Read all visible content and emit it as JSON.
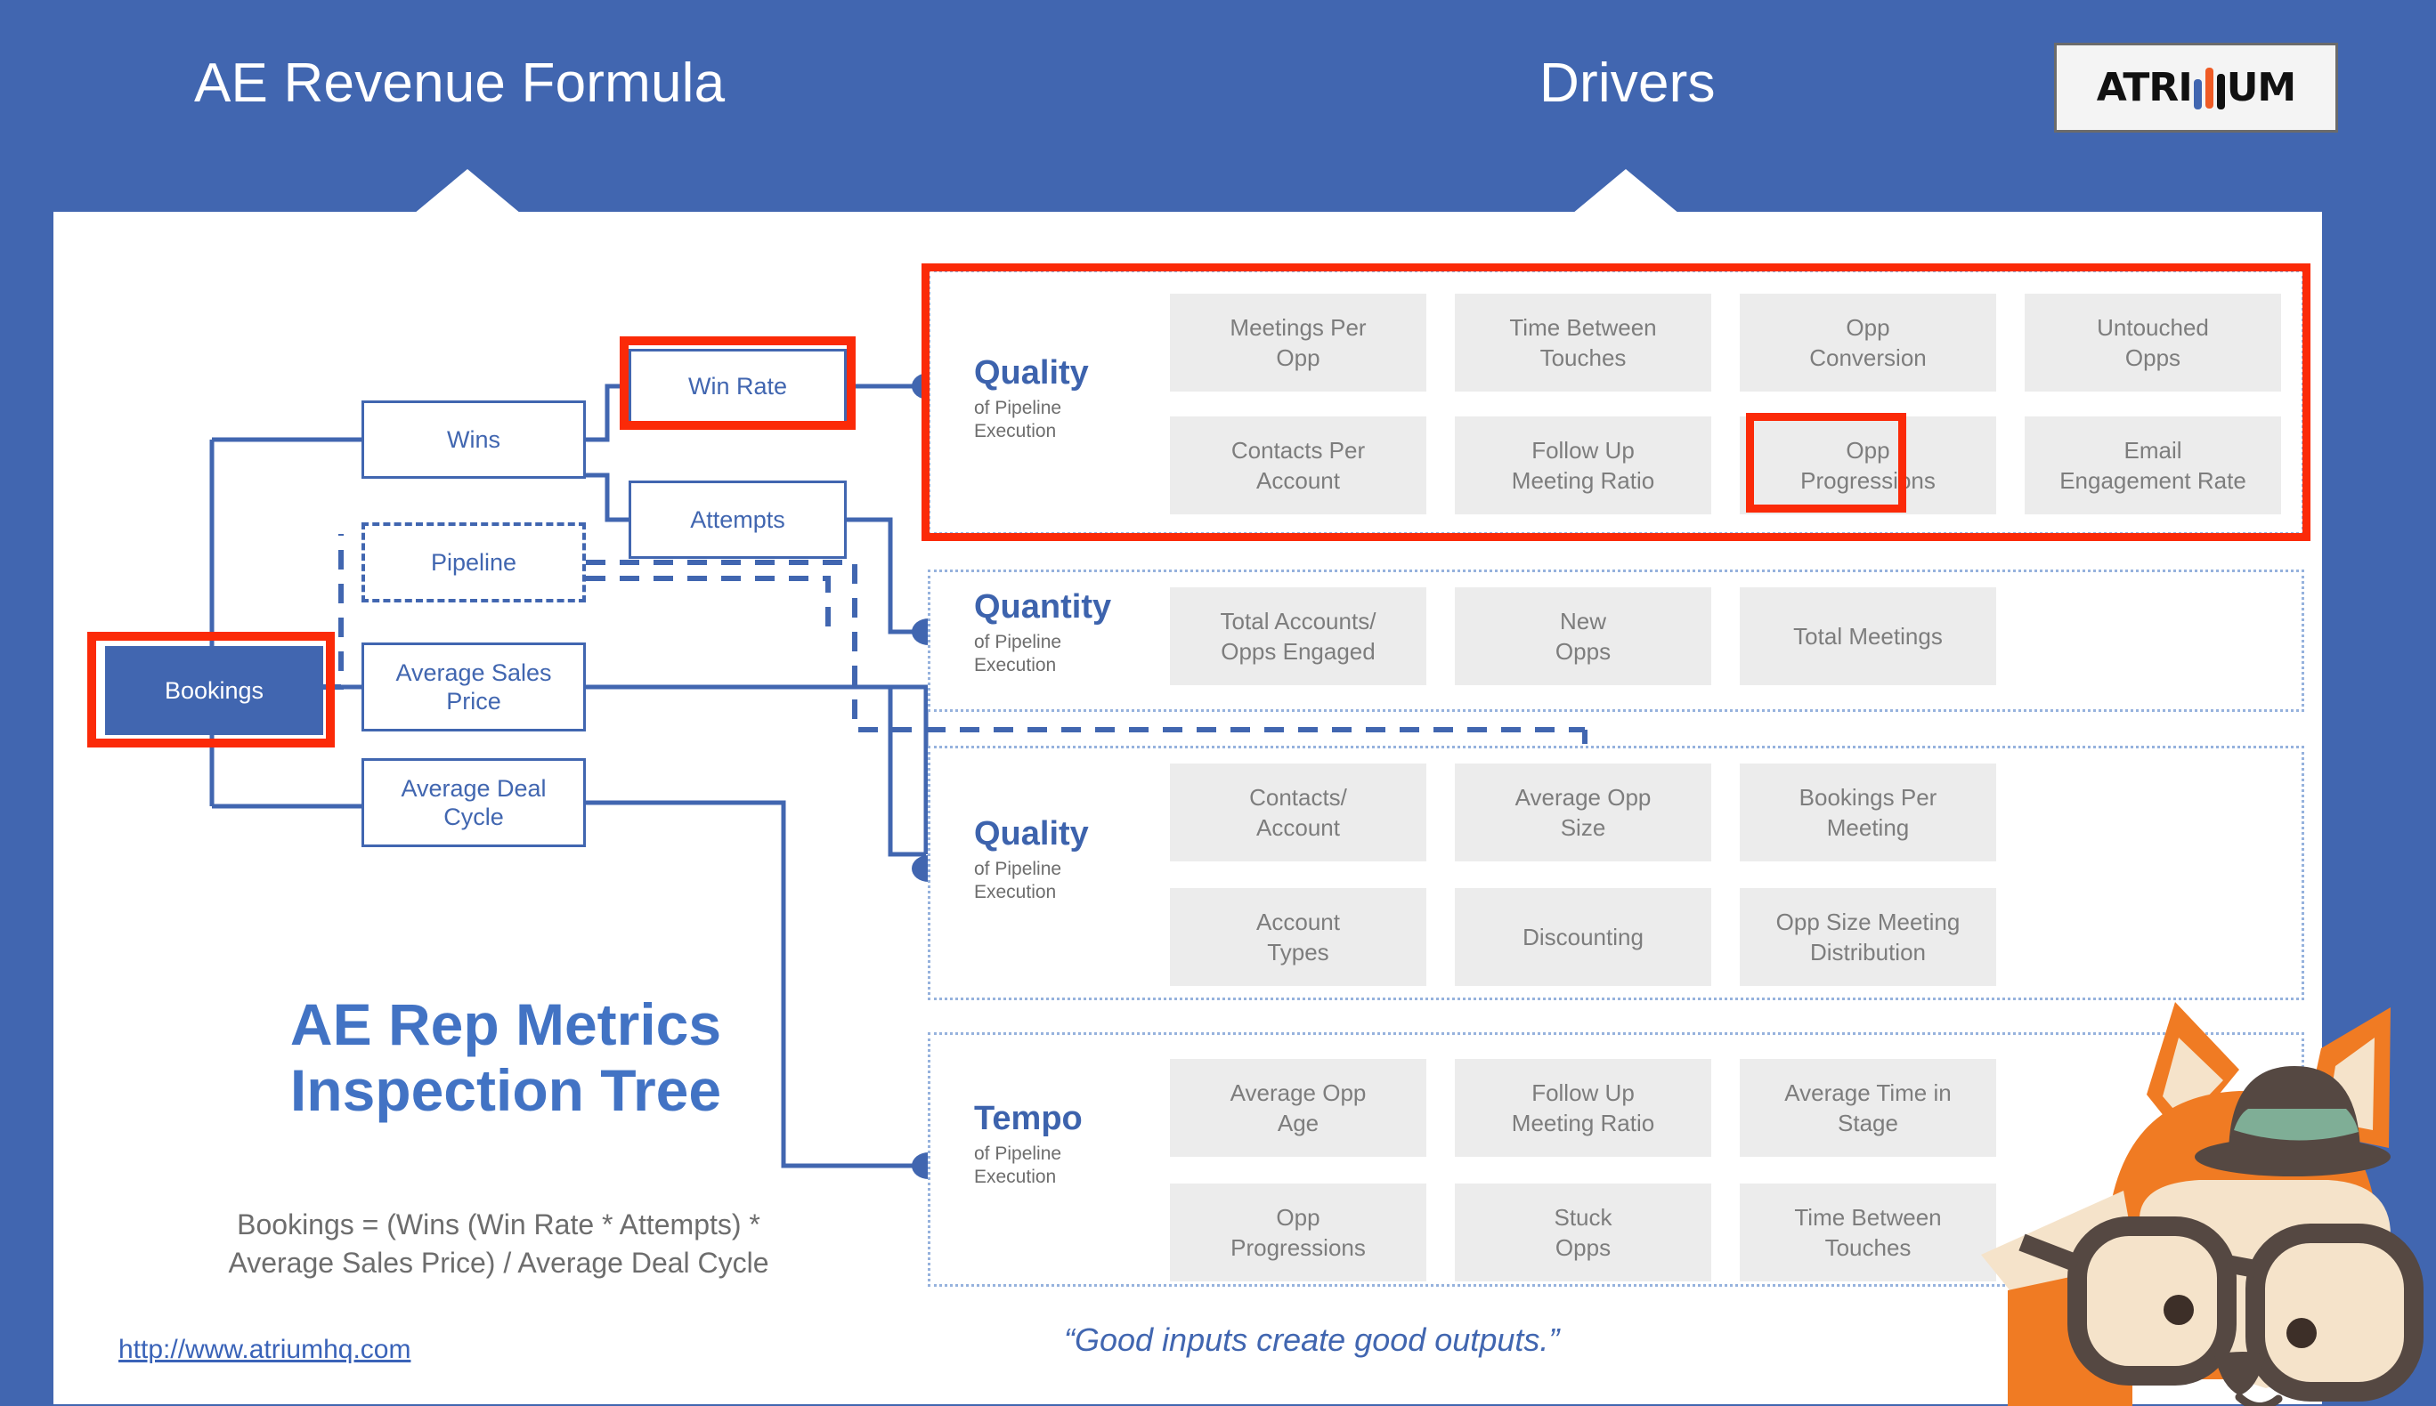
{
  "header": {
    "left_title": "AE Revenue Formula",
    "right_title": "Drivers",
    "logo": {
      "text_left": "ATRI",
      "text_right": "UM"
    }
  },
  "tree": {
    "root": "Bookings",
    "nodes": {
      "wins": "Wins",
      "win_rate": "Win Rate",
      "attempts": "Attempts",
      "pipeline": "Pipeline",
      "average_sales_price": "Average Sales\nPrice",
      "average_deal_cycle": "Average Deal\nCycle"
    }
  },
  "drivers": [
    {
      "id": "quality-1",
      "title": "Quality",
      "subtitle": "of Pipeline\nExecution",
      "highlighted": true,
      "cards": [
        "Meetings Per\nOpp",
        "Time Between\nTouches",
        "Opp\nConversion",
        "Untouched\nOpps",
        "Contacts Per\nAccount",
        "Follow Up\nMeeting Ratio",
        "Opp\nProgressions",
        "Email\nEngagement Rate"
      ],
      "highlighted_card": "Opp\nProgressions"
    },
    {
      "id": "quantity",
      "title": "Quantity",
      "subtitle": "of Pipeline\nExecution",
      "highlighted": false,
      "cards": [
        "Total Accounts/\nOpps Engaged",
        "New\nOpps",
        "Total Meetings"
      ]
    },
    {
      "id": "quality-2",
      "title": "Quality",
      "subtitle": "of Pipeline\nExecution",
      "highlighted": false,
      "cards": [
        "Contacts/\nAccount",
        "Average Opp\nSize",
        "Bookings Per\nMeeting",
        "Account\nTypes",
        "Discounting",
        "Opp Size Meeting\nDistribution"
      ]
    },
    {
      "id": "tempo",
      "title": "Tempo",
      "subtitle": "of Pipeline\nExecution",
      "highlighted": false,
      "cards": [
        "Average Opp\nAge",
        "Follow Up\nMeeting Ratio",
        "Average Time in\nStage",
        "Opp\nProgressions",
        "Stuck\nOpps",
        "Time Between\nTouches"
      ]
    }
  ],
  "footer": {
    "main_title": "AE Rep Metrics\nInspection Tree",
    "formula": "Bookings = (Wins (Win Rate * Attempts) *\nAverage Sales Price) / Average Deal Cycle",
    "link": "http://www.atriumhq.com",
    "quote": "“Good inputs create good outputs.”"
  },
  "colors": {
    "brand_blue": "#4166b0",
    "accent_red": "#fb2a08",
    "card_gray": "#ececec",
    "fox_orange": "#f07b23",
    "fox_cream": "#f5e3ca",
    "fox_dark": "#554842",
    "hat_band_green": "#7fae96"
  }
}
